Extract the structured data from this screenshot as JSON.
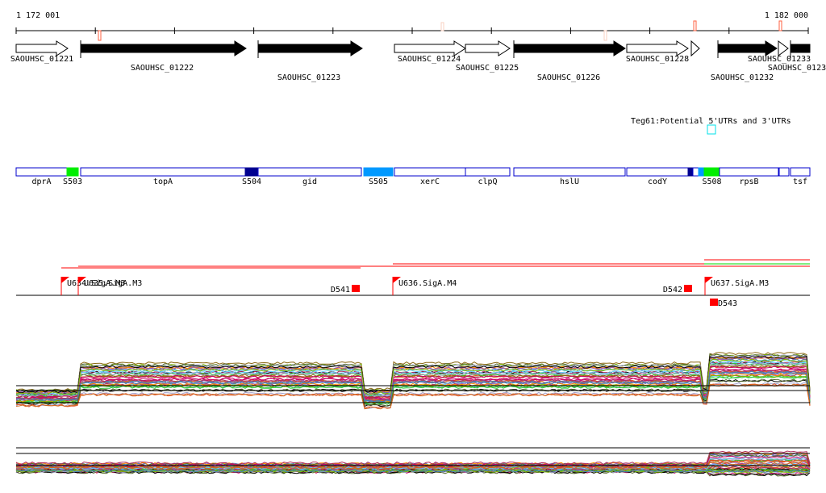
{
  "scale": {
    "start_label": "1 172 001",
    "end_label": "1 182 000"
  },
  "genes": [
    {
      "label": "SAOUHSC_01221",
      "style": "open"
    },
    {
      "label": "SAOUHSC_01222",
      "style": "filled"
    },
    {
      "label": "SAOUHSC_01223",
      "style": "filled"
    },
    {
      "label": "SAOUHSC_01224",
      "style": "open"
    },
    {
      "label": "SAOUHSC_01225",
      "style": "open"
    },
    {
      "label": "SAOUHSC_01226",
      "style": "filled"
    },
    {
      "label": "SAOUHSC_01228",
      "style": "open"
    },
    {
      "label": "",
      "style": "open"
    },
    {
      "label": "SAOUHSC_01232",
      "style": "filled"
    },
    {
      "label": "SAOUHSC_01233",
      "style": "open"
    },
    {
      "label": "SAOUHSC_0123",
      "style": "filled"
    }
  ],
  "teg": {
    "label": "Teg61:Potential 5'UTRs and 3'UTRs",
    "color": "#00e0e8"
  },
  "annotations": [
    {
      "label": "dprA",
      "color": "#ffffff"
    },
    {
      "label": "S503",
      "color": "#00ee00"
    },
    {
      "label": "topA",
      "color": "#ffffff"
    },
    {
      "label": "S504",
      "color": "#000090"
    },
    {
      "label": "gid",
      "color": "#ffffff"
    },
    {
      "label": "S505",
      "color": "#0099ff"
    },
    {
      "label": "xerC",
      "color": "#ffffff"
    },
    {
      "label": "clpQ",
      "color": "#ffffff"
    },
    {
      "label": "hslU",
      "color": "#ffffff"
    },
    {
      "label": "codY",
      "color": "#ffffff"
    },
    {
      "label": "",
      "color": "#000090"
    },
    {
      "label": "",
      "color": "#ffffff"
    },
    {
      "label": "",
      "color": "#0099ff"
    },
    {
      "label": "S508",
      "color": "#00ee00"
    },
    {
      "label": "rpsB",
      "color": "#ffffff"
    },
    {
      "label": "",
      "color": "#ffffff"
    },
    {
      "label": "tsf",
      "color": "#ffffff"
    }
  ],
  "promoters": [
    {
      "label": "U634.SigA.M3"
    },
    {
      "label": "U635.SigA.M3"
    },
    {
      "label": "U636.SigA.M4"
    },
    {
      "label": "U637.SigA.M3"
    }
  ],
  "terminators": [
    {
      "label": "D541"
    },
    {
      "label": "D542"
    },
    {
      "label": "D543"
    }
  ],
  "colors": {
    "feature": "#ff0000",
    "annotation_border": "#0000cc",
    "segment_green": "#00dd00"
  }
}
